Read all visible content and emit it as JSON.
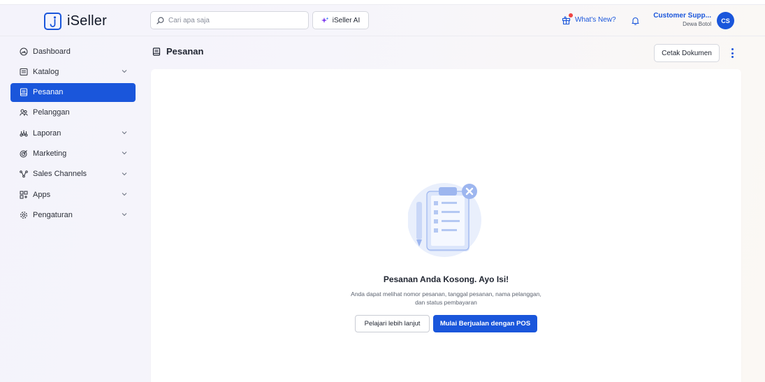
{
  "header": {
    "brand": "iSeller",
    "search_placeholder": "Cari apa saja",
    "ai_label": "iSeller AI",
    "whats_new_label": "What's New?",
    "user_name": "Customer Supp...",
    "user_store": "Dewa Botol",
    "avatar_initials": "CS"
  },
  "sidebar": {
    "items": [
      {
        "label": "Dashboard",
        "icon": "dashboard-icon",
        "has_children": false
      },
      {
        "label": "Katalog",
        "icon": "catalog-icon",
        "has_children": true
      },
      {
        "label": "Pesanan",
        "icon": "orders-icon",
        "has_children": false,
        "active": true
      },
      {
        "label": "Pelanggan",
        "icon": "customers-icon",
        "has_children": false
      },
      {
        "label": "Laporan",
        "icon": "reports-icon",
        "has_children": true
      },
      {
        "label": "Marketing",
        "icon": "marketing-icon",
        "has_children": true
      },
      {
        "label": "Sales Channels",
        "icon": "sales-channels-icon",
        "has_children": true
      },
      {
        "label": "Apps",
        "icon": "apps-icon",
        "has_children": true
      },
      {
        "label": "Pengaturan",
        "icon": "settings-icon",
        "has_children": true
      }
    ]
  },
  "main": {
    "page_title": "Pesanan",
    "print_button": "Cetak Dokumen",
    "empty_title": "Pesanan Anda Kosong. Ayo Isi!",
    "empty_desc_line1": "Anda dapat melihat nomor pesanan, tanggal pesanan, nama pelanggan,",
    "empty_desc_line2": "dan status pembayaran",
    "learn_more_button": "Pelajari lebih lanjut",
    "start_pos_button": "Mulai Berjualan dengan POS"
  },
  "colors": {
    "accent": "#1a56db",
    "notification_dot": "#ef4444",
    "illustration_light": "#dce6fb"
  }
}
